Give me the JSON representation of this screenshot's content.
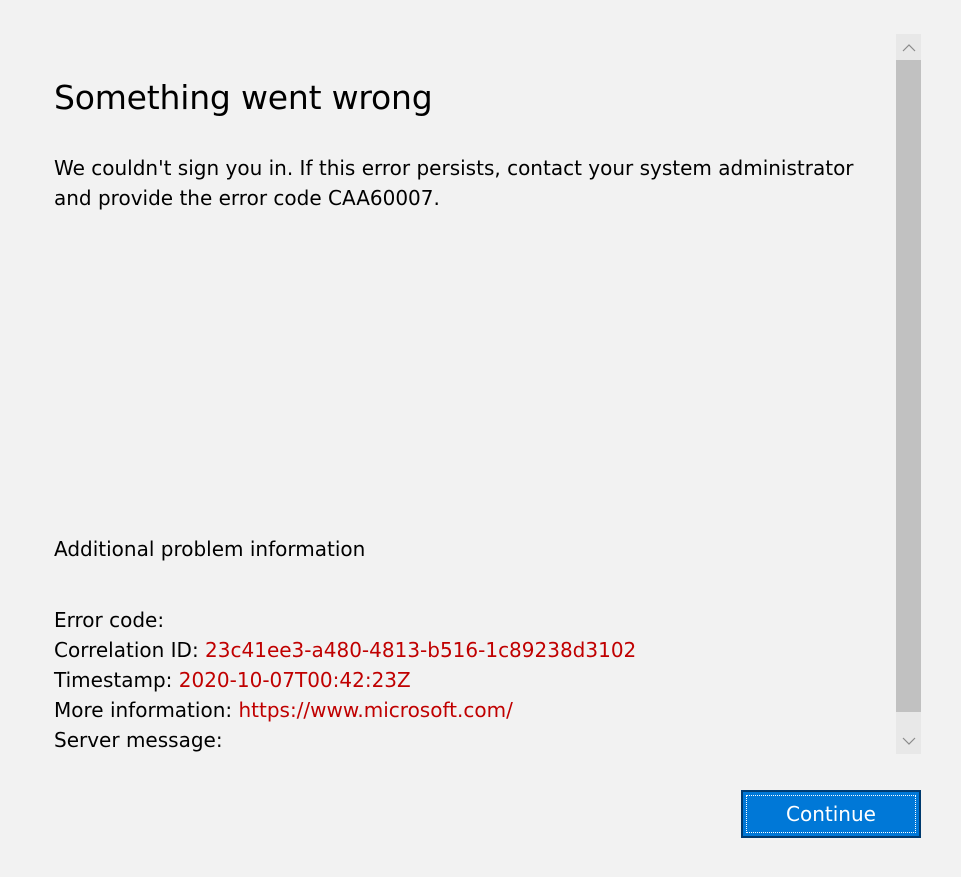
{
  "dialog": {
    "title": "Something went wrong",
    "message": "We couldn't sign you in. If this error persists, contact your system administrator and provide the error code CAA60007.",
    "additional_heading": "Additional problem information"
  },
  "details": {
    "error_code": {
      "label": "Error code:",
      "value": ""
    },
    "correlation_id": {
      "label": "Correlation ID:",
      "value": "23c41ee3-a480-4813-b516-1c89238d3102"
    },
    "timestamp": {
      "label": "Timestamp:",
      "value": "2020-10-07T00:42:23Z"
    },
    "more_information": {
      "label": "More information:",
      "value": "https://www.microsoft.com/"
    },
    "server_message": {
      "label": "Server message:",
      "value": ""
    }
  },
  "buttons": {
    "continue_label": "Continue"
  },
  "scrollbar": {
    "up_icon": "chevron-up-icon",
    "down_icon": "chevron-down-icon"
  },
  "colors": {
    "background": "#f2f2f2",
    "value_text": "#c00000",
    "button_fill": "#0078d7",
    "button_border": "#003a6e",
    "scroll_thumb": "#c1c1c1"
  }
}
